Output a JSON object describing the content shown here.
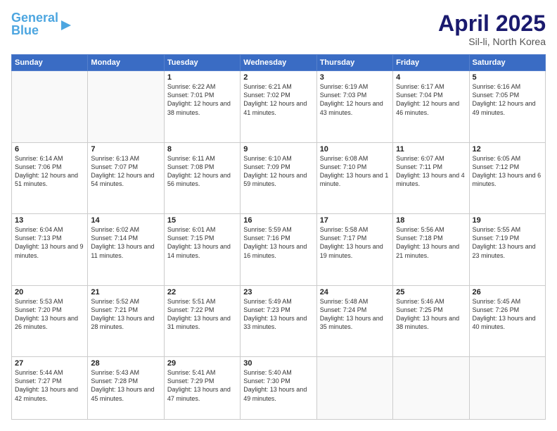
{
  "header": {
    "logo_line1": "General",
    "logo_line2": "Blue",
    "title": "April 2025",
    "subtitle": "Sil-li, North Korea"
  },
  "weekdays": [
    "Sunday",
    "Monday",
    "Tuesday",
    "Wednesday",
    "Thursday",
    "Friday",
    "Saturday"
  ],
  "weeks": [
    [
      {
        "day": "",
        "info": ""
      },
      {
        "day": "",
        "info": ""
      },
      {
        "day": "1",
        "info": "Sunrise: 6:22 AM\nSunset: 7:01 PM\nDaylight: 12 hours and 38 minutes."
      },
      {
        "day": "2",
        "info": "Sunrise: 6:21 AM\nSunset: 7:02 PM\nDaylight: 12 hours and 41 minutes."
      },
      {
        "day": "3",
        "info": "Sunrise: 6:19 AM\nSunset: 7:03 PM\nDaylight: 12 hours and 43 minutes."
      },
      {
        "day": "4",
        "info": "Sunrise: 6:17 AM\nSunset: 7:04 PM\nDaylight: 12 hours and 46 minutes."
      },
      {
        "day": "5",
        "info": "Sunrise: 6:16 AM\nSunset: 7:05 PM\nDaylight: 12 hours and 49 minutes."
      }
    ],
    [
      {
        "day": "6",
        "info": "Sunrise: 6:14 AM\nSunset: 7:06 PM\nDaylight: 12 hours and 51 minutes."
      },
      {
        "day": "7",
        "info": "Sunrise: 6:13 AM\nSunset: 7:07 PM\nDaylight: 12 hours and 54 minutes."
      },
      {
        "day": "8",
        "info": "Sunrise: 6:11 AM\nSunset: 7:08 PM\nDaylight: 12 hours and 56 minutes."
      },
      {
        "day": "9",
        "info": "Sunrise: 6:10 AM\nSunset: 7:09 PM\nDaylight: 12 hours and 59 minutes."
      },
      {
        "day": "10",
        "info": "Sunrise: 6:08 AM\nSunset: 7:10 PM\nDaylight: 13 hours and 1 minute."
      },
      {
        "day": "11",
        "info": "Sunrise: 6:07 AM\nSunset: 7:11 PM\nDaylight: 13 hours and 4 minutes."
      },
      {
        "day": "12",
        "info": "Sunrise: 6:05 AM\nSunset: 7:12 PM\nDaylight: 13 hours and 6 minutes."
      }
    ],
    [
      {
        "day": "13",
        "info": "Sunrise: 6:04 AM\nSunset: 7:13 PM\nDaylight: 13 hours and 9 minutes."
      },
      {
        "day": "14",
        "info": "Sunrise: 6:02 AM\nSunset: 7:14 PM\nDaylight: 13 hours and 11 minutes."
      },
      {
        "day": "15",
        "info": "Sunrise: 6:01 AM\nSunset: 7:15 PM\nDaylight: 13 hours and 14 minutes."
      },
      {
        "day": "16",
        "info": "Sunrise: 5:59 AM\nSunset: 7:16 PM\nDaylight: 13 hours and 16 minutes."
      },
      {
        "day": "17",
        "info": "Sunrise: 5:58 AM\nSunset: 7:17 PM\nDaylight: 13 hours and 19 minutes."
      },
      {
        "day": "18",
        "info": "Sunrise: 5:56 AM\nSunset: 7:18 PM\nDaylight: 13 hours and 21 minutes."
      },
      {
        "day": "19",
        "info": "Sunrise: 5:55 AM\nSunset: 7:19 PM\nDaylight: 13 hours and 23 minutes."
      }
    ],
    [
      {
        "day": "20",
        "info": "Sunrise: 5:53 AM\nSunset: 7:20 PM\nDaylight: 13 hours and 26 minutes."
      },
      {
        "day": "21",
        "info": "Sunrise: 5:52 AM\nSunset: 7:21 PM\nDaylight: 13 hours and 28 minutes."
      },
      {
        "day": "22",
        "info": "Sunrise: 5:51 AM\nSunset: 7:22 PM\nDaylight: 13 hours and 31 minutes."
      },
      {
        "day": "23",
        "info": "Sunrise: 5:49 AM\nSunset: 7:23 PM\nDaylight: 13 hours and 33 minutes."
      },
      {
        "day": "24",
        "info": "Sunrise: 5:48 AM\nSunset: 7:24 PM\nDaylight: 13 hours and 35 minutes."
      },
      {
        "day": "25",
        "info": "Sunrise: 5:46 AM\nSunset: 7:25 PM\nDaylight: 13 hours and 38 minutes."
      },
      {
        "day": "26",
        "info": "Sunrise: 5:45 AM\nSunset: 7:26 PM\nDaylight: 13 hours and 40 minutes."
      }
    ],
    [
      {
        "day": "27",
        "info": "Sunrise: 5:44 AM\nSunset: 7:27 PM\nDaylight: 13 hours and 42 minutes."
      },
      {
        "day": "28",
        "info": "Sunrise: 5:43 AM\nSunset: 7:28 PM\nDaylight: 13 hours and 45 minutes."
      },
      {
        "day": "29",
        "info": "Sunrise: 5:41 AM\nSunset: 7:29 PM\nDaylight: 13 hours and 47 minutes."
      },
      {
        "day": "30",
        "info": "Sunrise: 5:40 AM\nSunset: 7:30 PM\nDaylight: 13 hours and 49 minutes."
      },
      {
        "day": "",
        "info": ""
      },
      {
        "day": "",
        "info": ""
      },
      {
        "day": "",
        "info": ""
      }
    ]
  ]
}
